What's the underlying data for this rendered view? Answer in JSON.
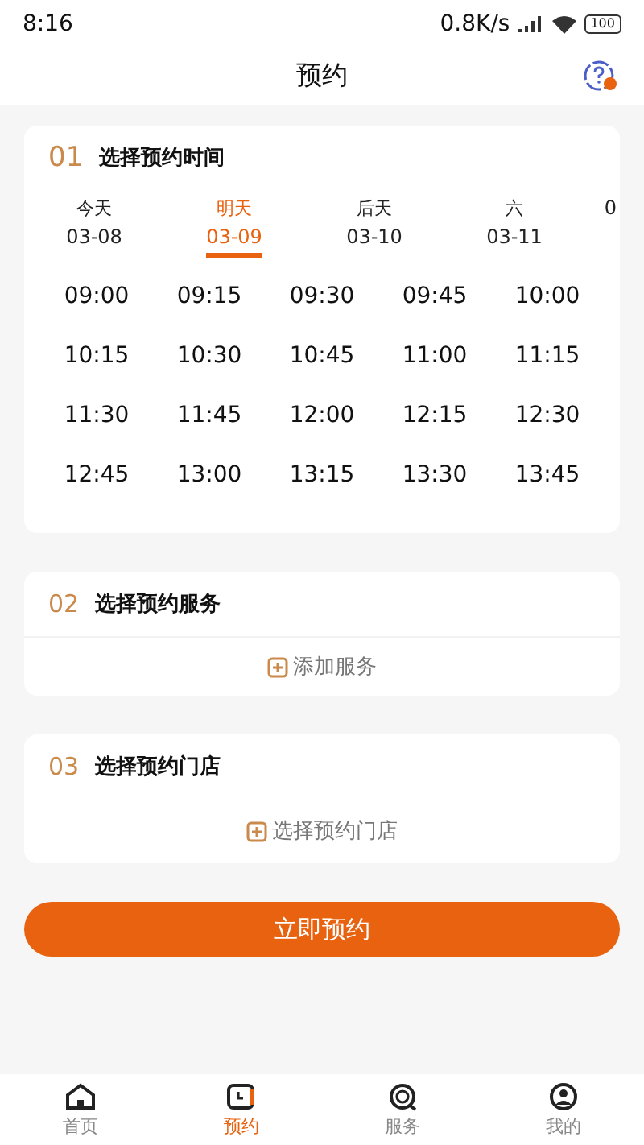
{
  "status_bar": {
    "time": "8:16",
    "speed": "0.8K/s",
    "battery": "100"
  },
  "header": {
    "title": "预约"
  },
  "time_section": {
    "number": "01",
    "title": "选择预约时间",
    "dates": [
      {
        "day": "今天",
        "date": "03-08",
        "selected": false
      },
      {
        "day": "明天",
        "date": "03-09",
        "selected": true
      },
      {
        "day": "后天",
        "date": "03-10",
        "selected": false
      },
      {
        "day": "六",
        "date": "03-11",
        "selected": false
      },
      {
        "date": "0",
        "selected": false
      }
    ],
    "times": [
      "09:00",
      "09:15",
      "09:30",
      "09:45",
      "10:00",
      "10:15",
      "10:30",
      "10:45",
      "11:00",
      "11:15",
      "11:30",
      "11:45",
      "12:00",
      "12:15",
      "12:30",
      "12:45",
      "13:00",
      "13:15",
      "13:30",
      "13:45"
    ]
  },
  "service_section": {
    "number": "02",
    "title": "选择预约服务",
    "action": "添加服务"
  },
  "store_section": {
    "number": "03",
    "title": "选择预约门店",
    "action": "选择预约门店"
  },
  "submit_button": "立即预约",
  "tab_bar": [
    {
      "label": "首页",
      "selected": false
    },
    {
      "label": "预约",
      "selected": true
    },
    {
      "label": "服务",
      "selected": false
    },
    {
      "label": "我的",
      "selected": false
    }
  ]
}
